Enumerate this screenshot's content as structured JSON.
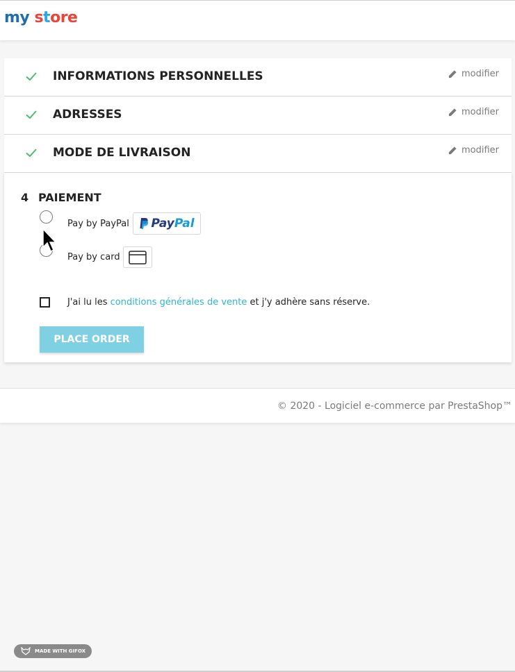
{
  "header": {
    "logo": {
      "my": "my",
      "store_s": "s",
      "store_t": "t",
      "store_ore": "ore"
    }
  },
  "steps": [
    {
      "title": "INFORMATIONS PERSONNELLES",
      "edit_label": "modifier",
      "status": "check-icon"
    },
    {
      "title": "ADRESSES",
      "edit_label": "modifier",
      "status": "check-icon"
    },
    {
      "title": "MODE DE LIVRAISON",
      "edit_label": "modifier",
      "status": "check-icon"
    }
  ],
  "payment": {
    "number": "4",
    "title": "PAIEMENT",
    "options": [
      {
        "label": "Pay by PayPal",
        "logo": {
          "pay": "Pay",
          "pal": "Pal"
        },
        "selected": false
      },
      {
        "label": "Pay by card",
        "logo": "card-icon",
        "selected": false
      }
    ],
    "terms": {
      "prefix": "J'ai lu les ",
      "link": "conditions générales de vente",
      "suffix": " et j'y adhère sans réserve.",
      "checked": false
    },
    "place_order_label": "PLACE ORDER"
  },
  "footer": {
    "copyright": "© 2020 - Logiciel e-commerce par PrestaShop™"
  },
  "badge": {
    "text": "MADE WITH GIFOX"
  },
  "colors": {
    "accent": "#2fb5d2",
    "check": "#4cbb6c",
    "button_disabled": "#7fd0e3",
    "paypal_dark": "#253b80",
    "paypal_light": "#179bd7"
  }
}
